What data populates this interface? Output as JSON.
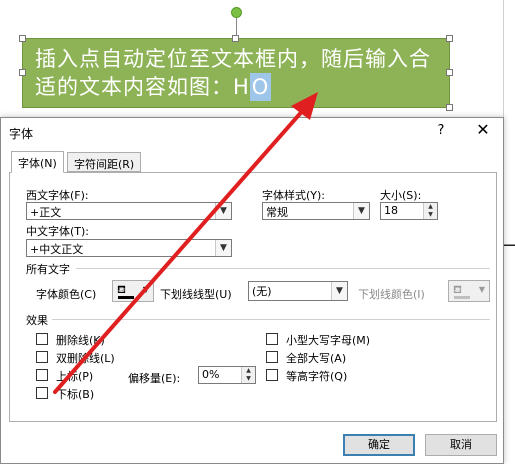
{
  "slide": {
    "textbox_text": "插入点自动定位至文本框内，随后输入合适的文本内容如图：",
    "typed_text": "H",
    "cursor_char": "O",
    "background_char": "—"
  },
  "dialog": {
    "title": "字体",
    "help": "?",
    "close": "✕",
    "tabs": [
      "字体(N)",
      "字符间距(R)"
    ],
    "western_font_label": "西文字体(F):",
    "western_font_value": "+正文",
    "chinese_font_label": "中文字体(T):",
    "chinese_font_value": "+中文正文",
    "style_label": "字体样式(Y):",
    "style_value": "常规",
    "size_label": "大小(S):",
    "size_value": "18",
    "all_text_label": "所有文字",
    "font_color_label": "字体颜色(C)",
    "underline_type_label": "下划线线型(U)",
    "underline_type_value": "(无)",
    "underline_color_label": "下划线颜色(I)",
    "effects_label": "效果",
    "effects_left": [
      "删除线(K)",
      "双删除线(L)",
      "上标(P)",
      "下标(B)"
    ],
    "effects_right": [
      "小型大写字母(M)",
      "全部大写(A)",
      "等高字符(Q)"
    ],
    "offset_label": "偏移量(E):",
    "offset_value": "0%",
    "ok": "确定",
    "cancel": "取消"
  },
  "colors": {
    "textbox_fill": "#8db356",
    "annotation_arrow": "#e02020",
    "default_button_border": "#3c7fb1"
  }
}
